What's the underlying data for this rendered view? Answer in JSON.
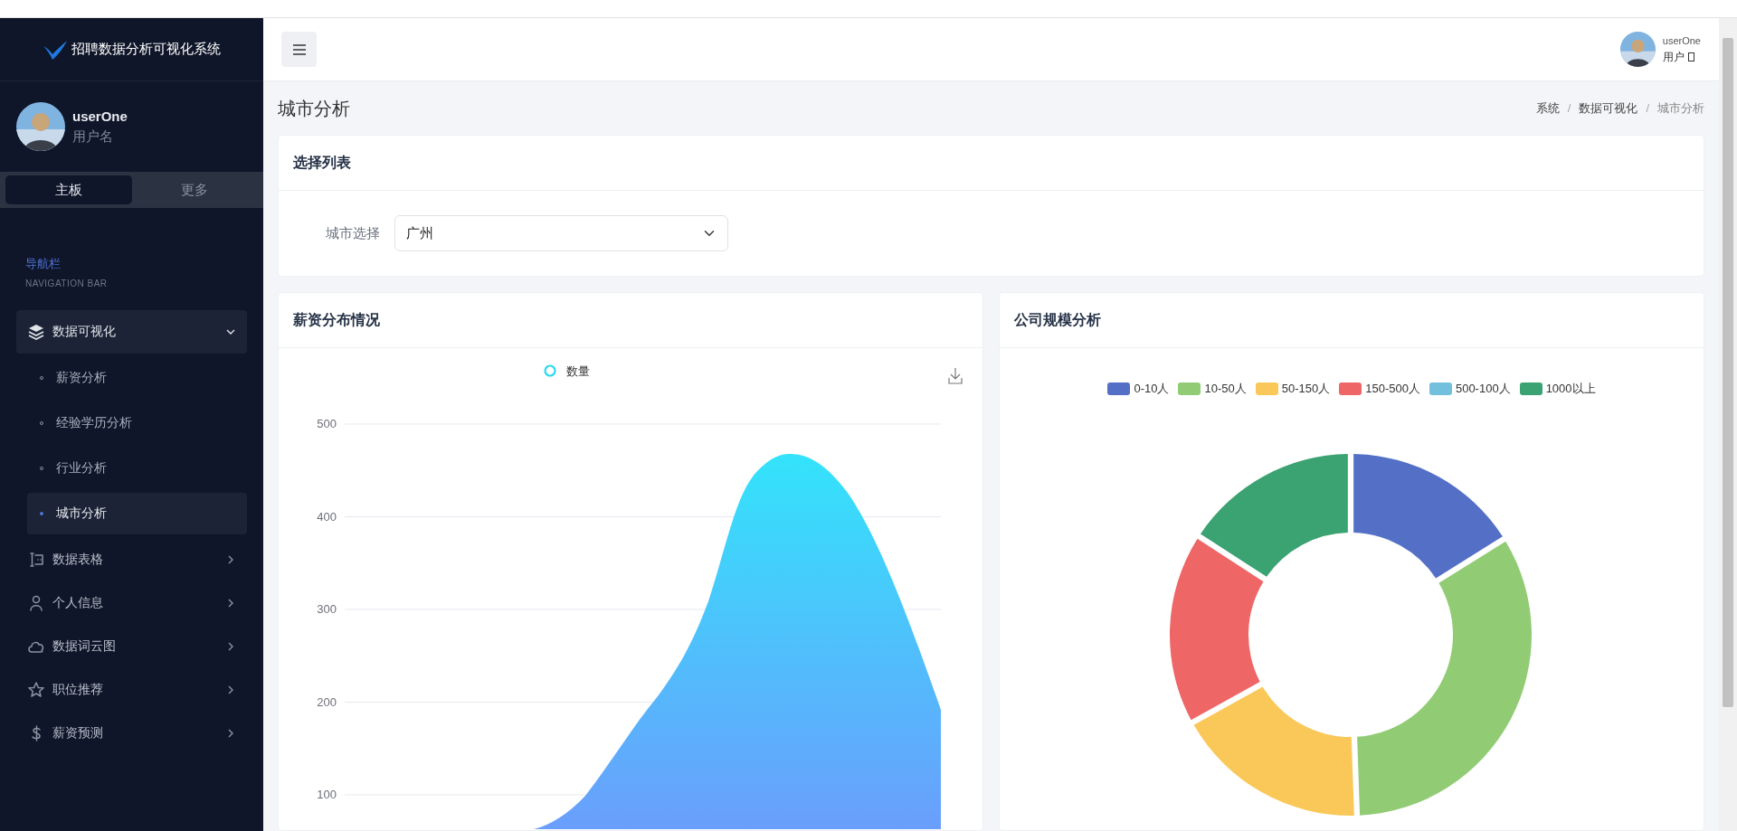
{
  "app": {
    "title": "招聘数据分析可视化系统"
  },
  "user": {
    "name": "userOne",
    "role": "用户名"
  },
  "sidebar_tabs": [
    {
      "label": "主板",
      "selected": true
    },
    {
      "label": "更多",
      "selected": false
    }
  ],
  "nav_heading": {
    "title": "导航栏",
    "subtitle": "NAVIGATION BAR"
  },
  "nav": [
    {
      "label": "数据可视化",
      "kind": "layers",
      "expanded": true,
      "children": [
        {
          "label": "薪资分析",
          "selected": false
        },
        {
          "label": "经验学历分析",
          "selected": false
        },
        {
          "label": "行业分析",
          "selected": false
        },
        {
          "label": "城市分析",
          "selected": true
        }
      ]
    },
    {
      "label": "数据表格",
      "kind": "table",
      "expanded": false
    },
    {
      "label": "个人信息",
      "kind": "person",
      "expanded": false
    },
    {
      "label": "数据词云图",
      "kind": "cloud",
      "expanded": false
    },
    {
      "label": "职位推荐",
      "kind": "star",
      "expanded": false
    },
    {
      "label": "薪资预测",
      "kind": "dollar",
      "expanded": false
    }
  ],
  "header": {
    "user": "userOne",
    "role": "用户"
  },
  "page": {
    "title": "城市分析",
    "breadcrumb": [
      {
        "label": "系统",
        "current": false
      },
      {
        "label": "数据可视化",
        "current": false
      },
      {
        "label": "城市分析",
        "current": true
      }
    ],
    "separators": [
      "/",
      "/"
    ]
  },
  "filter_card": {
    "title": "选择列表",
    "label": "城市选择",
    "value": "广州"
  },
  "salary_card": {
    "title": "薪资分布情况",
    "legend": "数量",
    "yticks": [
      "500",
      "400",
      "300",
      "200",
      "100"
    ]
  },
  "company_card": {
    "title": "公司规模分析",
    "legend": [
      {
        "label": "0-10人",
        "color": "#5470c6"
      },
      {
        "label": "10-50人",
        "color": "#91cc75"
      },
      {
        "label": "50-150人",
        "color": "#fac858"
      },
      {
        "label": "150-500人",
        "color": "#ee6666"
      },
      {
        "label": "500-100人",
        "color": "#73c0de"
      },
      {
        "label": "1000以上",
        "color": "#3ba272"
      }
    ]
  }
}
